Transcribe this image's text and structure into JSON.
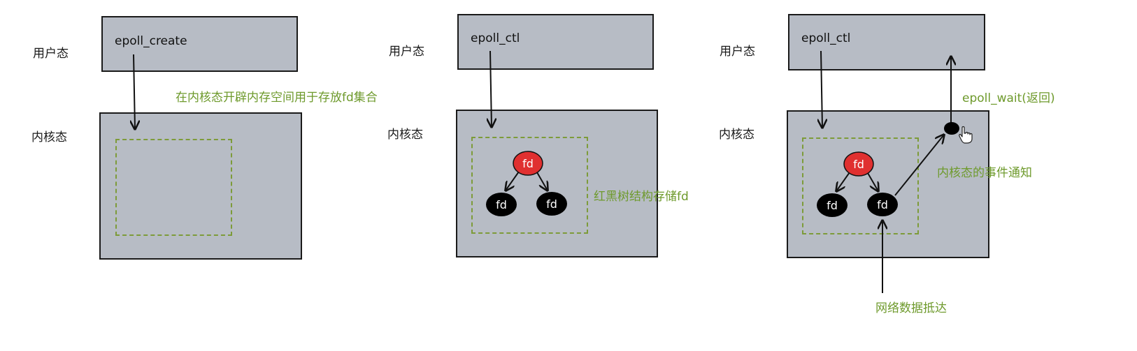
{
  "labels": {
    "user_mode": "用户态",
    "kernel_mode": "内核态"
  },
  "panels": [
    {
      "call": "epoll_create",
      "note": "在内核态开辟内存空间用于存放fd集合"
    },
    {
      "call": "epoll_ctl",
      "note": "红黑树结构存储fd",
      "tree": {
        "root": "fd",
        "left": "fd",
        "right": "fd"
      }
    },
    {
      "call": "epoll_ctl",
      "return_note": "epoll_wait(返回)",
      "event_note": "内核态的事件通知",
      "arrival_note": "网络数据抵达",
      "tree": {
        "root": "fd",
        "left": "fd",
        "right": "fd"
      }
    }
  ],
  "colors": {
    "box_fill": "#b7bcc5",
    "note_green": "#6e9a2c",
    "node_red": "#e03030",
    "node_black": "#000000"
  }
}
